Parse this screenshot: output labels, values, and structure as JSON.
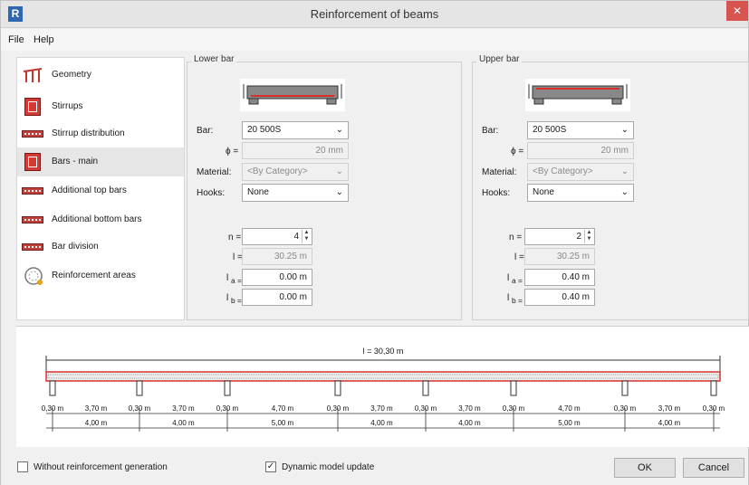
{
  "window": {
    "title": "Reinforcement of beams",
    "app_icon": "R",
    "close_glyph": "✕"
  },
  "menu": {
    "file": "File",
    "help": "Help"
  },
  "sidebar": {
    "items": [
      {
        "label": "Geometry",
        "icon": "geometry-icon"
      },
      {
        "label": "Stirrups",
        "icon": "stirrups-icon"
      },
      {
        "label": "Stirrup distribution",
        "icon": "stirrup-distribution-icon"
      },
      {
        "label": "Bars - main",
        "icon": "bars-main-icon",
        "selected": true
      },
      {
        "label": "Additional top bars",
        "icon": "additional-top-bars-icon"
      },
      {
        "label": "Additional bottom bars",
        "icon": "additional-bottom-bars-icon"
      },
      {
        "label": "Bar division",
        "icon": "bar-division-icon"
      },
      {
        "label": "Reinforcement areas",
        "icon": "reinforcement-areas-icon"
      }
    ]
  },
  "lower": {
    "title": "Lower bar",
    "bar_label": "Bar:",
    "bar_value": "20 500S",
    "phi_label": "ϕ =",
    "phi_value": "20 mm",
    "material_label": "Material:",
    "material_value": "<By Category>",
    "hooks_label": "Hooks:",
    "hooks_value": "None",
    "n_label": "n =",
    "n_value": "4",
    "l_label": "l =",
    "l_value": "30.25 m",
    "la_label": "a =",
    "la_value": "0.00 m",
    "lb_label": "b =",
    "lb_value": "0.00 m"
  },
  "upper": {
    "title": "Upper bar",
    "bar_label": "Bar:",
    "bar_value": "20 500S",
    "phi_label": "ϕ =",
    "phi_value": "20 mm",
    "material_label": "Material:",
    "material_value": "<By Category>",
    "hooks_label": "Hooks:",
    "hooks_value": "None",
    "n_label": "n =",
    "n_value": "2",
    "l_label": "l =",
    "l_value": "30.25 m",
    "la_label": "a =",
    "la_value": "0.40 m",
    "lb_label": "b =",
    "lb_value": "0.40 m"
  },
  "drawing": {
    "total_length": "l = 30,30 m",
    "support_widths": [
      "0,30 m",
      "0,30 m",
      "0,30 m",
      "0,30 m",
      "0,30 m",
      "0,30 m",
      "0,30 m",
      "0,30 m"
    ],
    "clear_spans": [
      "3,70 m",
      "3,70 m",
      "4,70 m",
      "3,70 m",
      "3,70 m",
      "4,70 m",
      "3,70 m"
    ],
    "axis_spans": [
      "4,00 m",
      "4,00 m",
      "5,00 m",
      "4,00 m",
      "4,00 m",
      "5,00 m",
      "4,00 m"
    ],
    "beam_color": "#d6302b"
  },
  "footer": {
    "without_generation": "Without reinforcement generation",
    "dynamic_update": "Dynamic model update",
    "ok": "OK",
    "cancel": "Cancel"
  }
}
